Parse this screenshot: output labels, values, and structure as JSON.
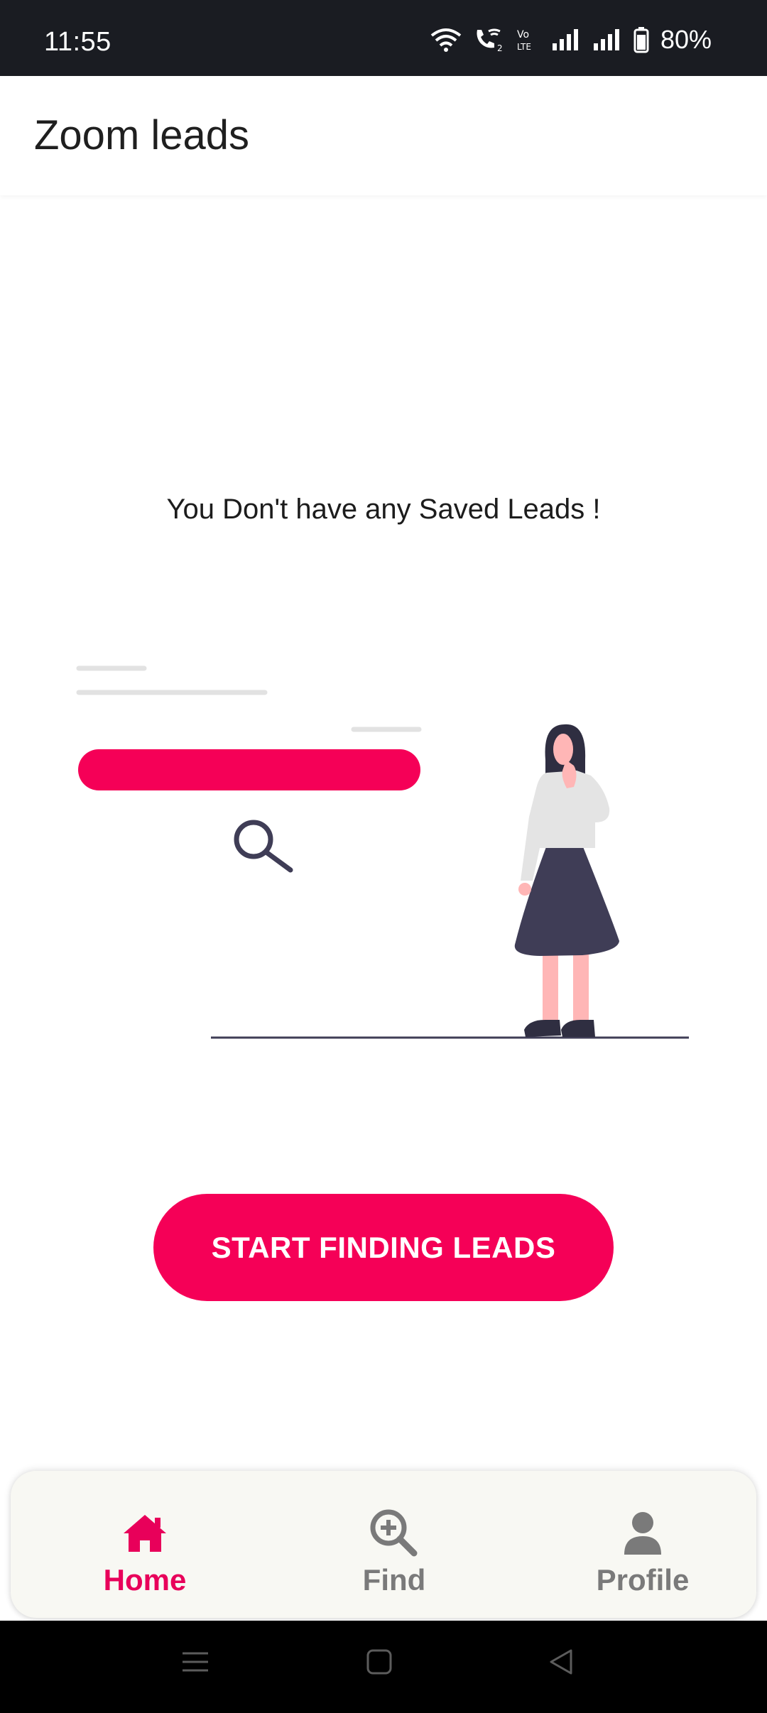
{
  "status_bar": {
    "time": "11:55",
    "battery": "80%",
    "icons": [
      "wifi-icon",
      "wifi-calling-icon",
      "volte-icon",
      "signal-icon",
      "signal-icon",
      "battery-icon"
    ]
  },
  "app_bar": {
    "title": "Zoom leads"
  },
  "main": {
    "empty_message": "You Don't have any Saved Leads !",
    "illustration": "search-illustration",
    "cta_label": "START FINDING LEADS"
  },
  "bottom_nav": {
    "items": [
      {
        "label": "Home",
        "icon": "home-icon",
        "active": true
      },
      {
        "label": "Find",
        "icon": "search-plus-icon",
        "active": false
      },
      {
        "label": "Profile",
        "icon": "person-icon",
        "active": false
      }
    ]
  },
  "colors": {
    "accent": "#f50057",
    "nav_active": "#e8005a",
    "nav_inactive": "#7a7a7a",
    "status_bar": "#1a1c22"
  }
}
